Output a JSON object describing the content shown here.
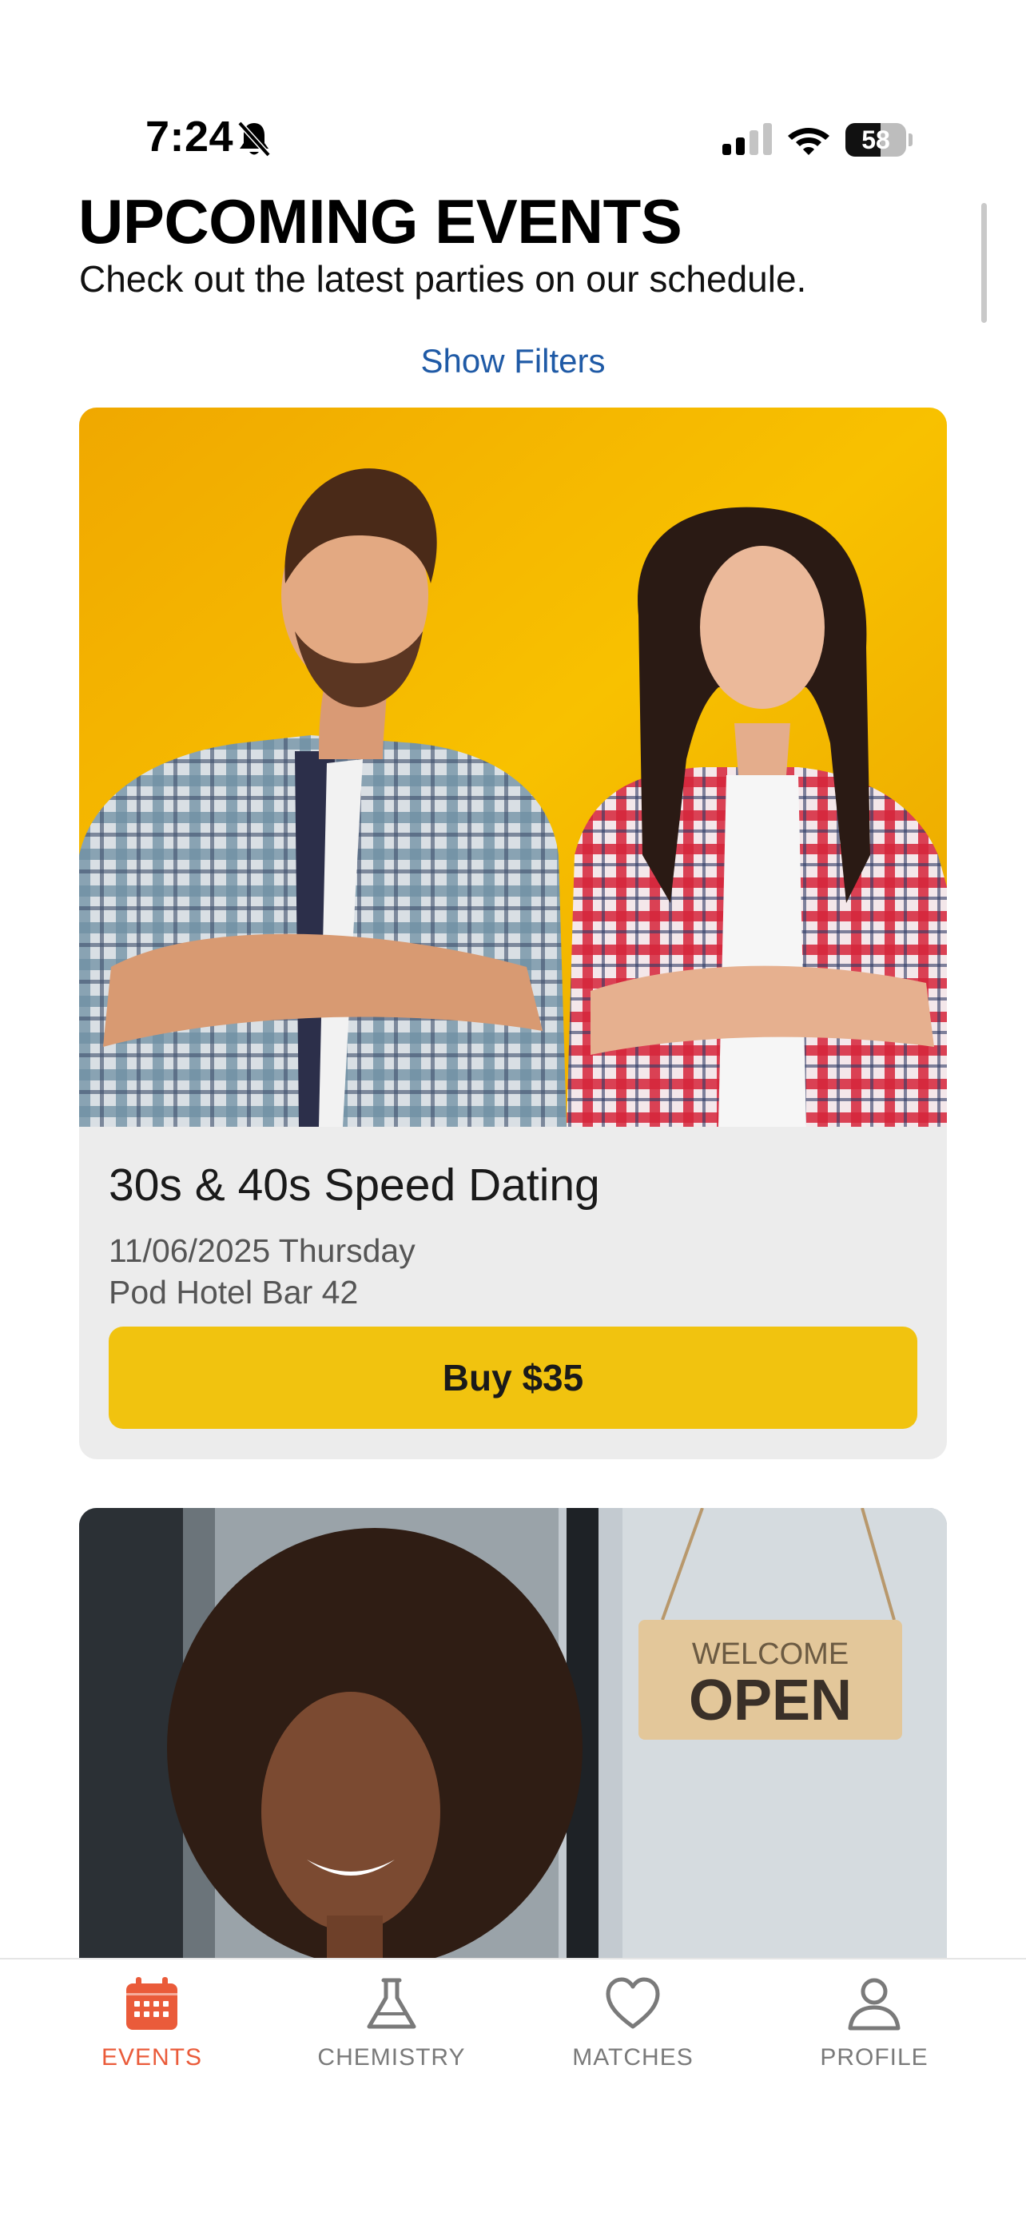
{
  "status_bar": {
    "time": "7:24",
    "battery_percent": 58,
    "battery_label": "58",
    "icons": [
      "bell-slash-icon",
      "cellular-signal-icon",
      "wifi-icon",
      "battery-icon"
    ]
  },
  "header": {
    "title": "UPCOMING EVENTS",
    "subtitle": "Check out the latest parties on our schedule.",
    "filters_label": "Show Filters"
  },
  "events": [
    {
      "title": "30s & 40s Speed Dating",
      "date": "11/06/2025 Thursday",
      "venue": "Pod Hotel Bar 42",
      "button_label": "Buy $35"
    },
    {
      "image_sign_top": "WELCOME",
      "image_sign_bottom": "OPEN"
    }
  ],
  "tab_bar": {
    "active": "EVENTS",
    "tabs": [
      {
        "label": "EVENTS",
        "icon": "calendar-icon"
      },
      {
        "label": "CHEMISTRY",
        "icon": "flask-icon"
      },
      {
        "label": "MATCHES",
        "icon": "heart-icon"
      },
      {
        "label": "PROFILE",
        "icon": "person-icon"
      }
    ]
  },
  "colors": {
    "accent": "#ea5b3a",
    "buy_button": "#f1c30f",
    "link": "#1f5aa6",
    "card_bg": "#ececec",
    "photo_bg": "#f5b400"
  }
}
